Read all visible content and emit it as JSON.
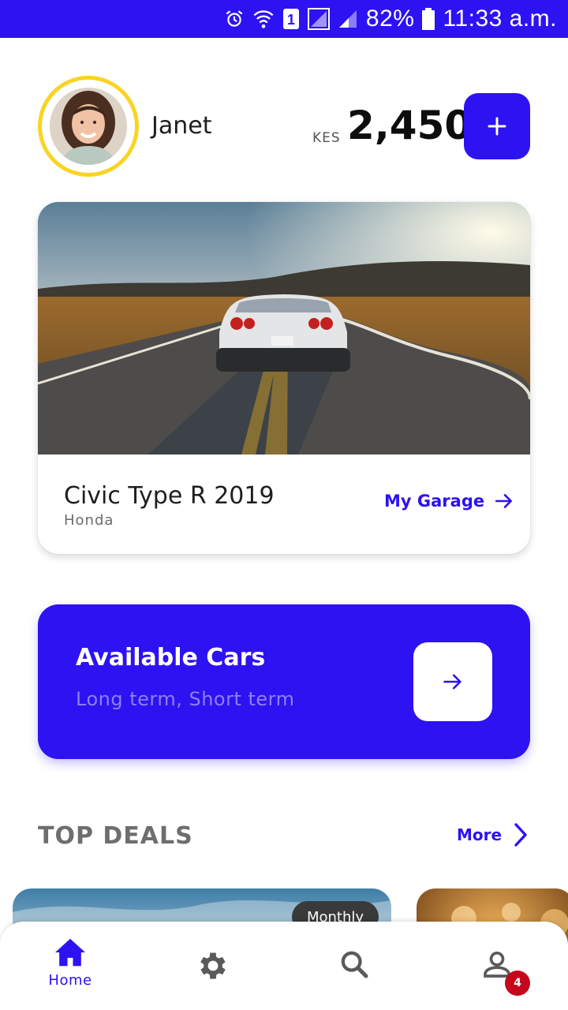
{
  "status_bar": {
    "battery": "82%",
    "time": "11:33 a.m.",
    "sim_number": "1",
    "icons": [
      "alarm-icon",
      "wifi-icon",
      "sim-icon",
      "signal-icon",
      "signal-icon",
      "battery-icon"
    ]
  },
  "header": {
    "user_name": "Janet",
    "currency": "KES",
    "balance": "2,450",
    "add_icon": "plus-icon"
  },
  "car_card": {
    "model": "Civic Type R 2019",
    "make": "Honda",
    "garage_label": "My Garage",
    "garage_icon": "arrow-right-icon"
  },
  "available_cars": {
    "title": "Available Cars",
    "subtitle": "Long term, Short term",
    "go_icon": "arrow-right-icon"
  },
  "top_deals": {
    "heading": "TOP DEALS",
    "more_label": "More",
    "more_icon": "chevron-right-icon",
    "cards": [
      {
        "badge": "Monthly"
      },
      {
        "badge": ""
      }
    ]
  },
  "bottom_nav": {
    "items": [
      {
        "label": "Home",
        "icon": "home-icon",
        "active": true
      },
      {
        "label": "",
        "icon": "gear-icon",
        "active": false
      },
      {
        "label": "",
        "icon": "search-icon",
        "active": false
      },
      {
        "label": "",
        "icon": "person-icon",
        "active": false,
        "badge": "4"
      }
    ]
  },
  "colors": {
    "primary": "#2d12f2",
    "avatar_ring": "#f9d424",
    "badge_red": "#c4071d",
    "muted_text": "#6e6e6e"
  }
}
